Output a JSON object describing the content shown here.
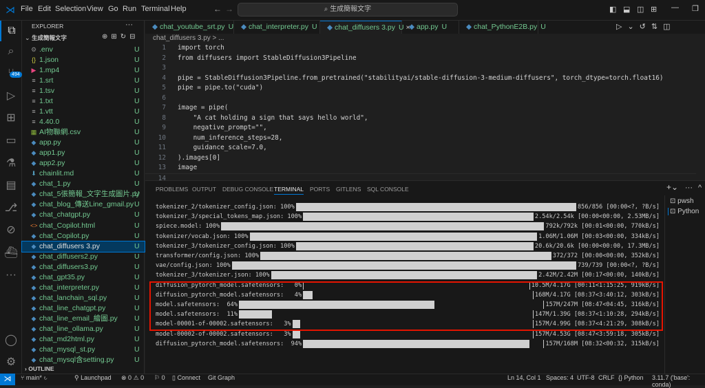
{
  "menu": [
    "File",
    "Edit",
    "Selection",
    "View",
    "Go",
    "Run",
    "Terminal",
    "Help"
  ],
  "search": "生成簡報文字",
  "activity_badge": "494",
  "explorer": {
    "title": "EXPLORER",
    "folder": "生成簡報文字",
    "outline": "OUTLINE",
    "files": [
      {
        "name": ".env",
        "icon": "gear",
        "status": "U"
      },
      {
        "name": "1.json",
        "icon": "json",
        "status": "U"
      },
      {
        "name": "1.mp4",
        "icon": "video",
        "status": "U"
      },
      {
        "name": "1.srt",
        "icon": "text",
        "status": "U"
      },
      {
        "name": "1.tsv",
        "icon": "text",
        "status": "U"
      },
      {
        "name": "1.txt",
        "icon": "text",
        "status": "U"
      },
      {
        "name": "1.vtt",
        "icon": "text",
        "status": "U"
      },
      {
        "name": "4.40.0",
        "icon": "text",
        "status": "U"
      },
      {
        "name": "AI物聯網.csv",
        "icon": "csv",
        "status": "U"
      },
      {
        "name": "app.py",
        "icon": "python",
        "status": "U"
      },
      {
        "name": "app1.py",
        "icon": "python",
        "status": "U"
      },
      {
        "name": "app2.py",
        "icon": "python",
        "status": "U"
      },
      {
        "name": "chainlit.md",
        "icon": "markdown",
        "status": "U"
      },
      {
        "name": "chat_1.py",
        "icon": "python",
        "status": "U"
      },
      {
        "name": "chat_5張簡報_文字生成圖片.py",
        "icon": "python",
        "status": "U"
      },
      {
        "name": "chat_blog_傳送Line_gmail.py",
        "icon": "python",
        "status": "U"
      },
      {
        "name": "chat_chatgpt.py",
        "icon": "python",
        "status": "U"
      },
      {
        "name": "chat_Copilot.html",
        "icon": "html",
        "status": "U"
      },
      {
        "name": "chat_Copilot.py",
        "icon": "python",
        "status": "U"
      },
      {
        "name": "chat_diffusers 3.py",
        "icon": "python",
        "status": "U",
        "selected": true
      },
      {
        "name": "chat_diffusers2.py",
        "icon": "python",
        "status": "U"
      },
      {
        "name": "chat_diffusers3.py",
        "icon": "python",
        "status": "U"
      },
      {
        "name": "chat_gpt35.py",
        "icon": "python",
        "status": "U"
      },
      {
        "name": "chat_interpreter.py",
        "icon": "python",
        "status": "U"
      },
      {
        "name": "chat_lanchain_sql.py",
        "icon": "python",
        "status": "U"
      },
      {
        "name": "chat_line_chatgpt.py",
        "icon": "python",
        "status": "U"
      },
      {
        "name": "chat_line_email_繪圖.py",
        "icon": "python",
        "status": "U"
      },
      {
        "name": "chat_line_ollama.py",
        "icon": "python",
        "status": "U"
      },
      {
        "name": "chat_md2html.py",
        "icon": "python",
        "status": "U"
      },
      {
        "name": "chat_mysql_st.py",
        "icon": "python",
        "status": "U"
      },
      {
        "name": "chat_mysql含setting.py",
        "icon": "python",
        "status": "U"
      }
    ]
  },
  "tabs": [
    {
      "name": "chat_youtube_srt.py",
      "status": "U"
    },
    {
      "name": "chat_interpreter.py",
      "status": "U"
    },
    {
      "name": "chat_diffusers 3.py",
      "status": "U",
      "active": true
    },
    {
      "name": "app.py",
      "status": "U"
    },
    {
      "name": "chat_PythonE2B.py",
      "status": "U"
    }
  ],
  "breadcrumb": "chat_diffusers 3.py > ...",
  "code": [
    "import torch",
    "from diffusers import StableDiffusion3Pipeline",
    "",
    "pipe = StableDiffusion3Pipeline.from_pretrained(\"stabilityai/stable-diffusion-3-medium-diffusers\", torch_dtype=torch.float16)",
    "pipe = pipe.to(\"cuda\")",
    "",
    "image = pipe(",
    "    \"A cat holding a sign that says hello world\",",
    "    negative_prompt=\"\",",
    "    num_inference_steps=28,",
    "    guidance_scale=7.0,",
    ").images[0]",
    "image",
    ""
  ],
  "panel_tabs": [
    "PROBLEMS",
    "OUTPUT",
    "DEBUG CONSOLE",
    "TERMINAL",
    "PORTS",
    "GITLENS",
    "SQL CONSOLE"
  ],
  "terminal_lines": [
    {
      "label": "tokenizer_2/tokenizer_config.json: 100%",
      "percent": 100,
      "stats": "856/856 [00:00<?, ?B/s]"
    },
    {
      "label": "tokenizer_3/special_tokens_map.json: 100%",
      "percent": 100,
      "stats": "2.54k/2.54k [00:00<00:00, 2.53MB/s]"
    },
    {
      "label": "spiece.model: 100%",
      "percent": 100,
      "stats": "792k/792k [00:01<00:00, 770kB/s]"
    },
    {
      "label": "tokenizer/vocab.json: 100%",
      "percent": 100,
      "stats": "1.06M/1.06M [00:03<00:00, 334kB/s]"
    },
    {
      "label": "tokenizer_3/tokenizer_config.json: 100%",
      "percent": 100,
      "stats": "20.6k/20.6k [00:00<00:00, 17.3MB/s]"
    },
    {
      "label": "transformer/config.json: 100%",
      "percent": 100,
      "stats": "372/372 [00:00<00:00, 352kB/s]"
    },
    {
      "label": "vae/config.json: 100%",
      "percent": 100,
      "stats": "739/739 [00:00<?, ?B/s]"
    },
    {
      "label": "tokenizer_3/tokenizer.json: 100%",
      "percent": 100,
      "stats": "2.42M/2.42M [00:17<00:00, 140kB/s]"
    },
    {
      "label": "diffusion_pytorch_model.safetensors:   0%",
      "percent": 0,
      "stats": "10.5M/4.17G [00:11<1:15:25, 919kB/s]"
    },
    {
      "label": "diffusion_pytorch_model.safetensors:   4%",
      "percent": 4,
      "stats": "168M/4.17G [08:37<3:40:12, 303kB/s]"
    },
    {
      "label": "model.safetensors:  64%",
      "percent": 64,
      "stats": "157M/247M [08:47<04:45, 316kB/s]"
    },
    {
      "label": "model.safetensors:  11%",
      "percent": 11,
      "stats": "147M/1.39G [08:37<1:10:28, 294kB/s]"
    },
    {
      "label": "model-00001-of-00002.safetensors:   3%",
      "percent": 3,
      "stats": "157M/4.99G [08:37<4:21:29, 308kB/s]"
    },
    {
      "label": "model-00002-of-00002.safetensors:   3%",
      "percent": 3,
      "stats": "157M/4.53G [08:47<3:59:18, 305kB/s]"
    },
    {
      "label": "diffusion_pytorch_model.safetensors:  94%",
      "percent": 94,
      "stats": "157M/168M [08:32<00:32, 315kB/s]"
    }
  ],
  "terminals": [
    "pwsh",
    "Python"
  ],
  "status": {
    "branch": "main*",
    "launchpad": "Launchpad",
    "errors": "0",
    "warnings": "0",
    "ports": "0",
    "connect": "Connect",
    "gitgraph": "Git Graph",
    "position": "Ln 14, Col 1",
    "spaces": "Spaces: 4",
    "encoding": "UTF-8",
    "eol": "CRLF",
    "language": "Python",
    "interpreter": "3.11.7 ('base': conda)"
  }
}
